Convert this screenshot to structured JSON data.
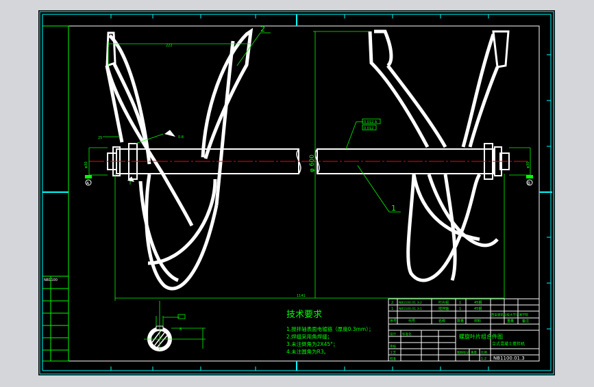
{
  "colors": {
    "viewport_bg": "#d4d6d9",
    "sheet_bg": "#000000",
    "line_white": "#ffffff",
    "line_green": "#00ff00",
    "center_red": "#ff0000",
    "outer_frame_cyan": "#00ffff",
    "text_yellow": "#ffff00"
  },
  "drawing": {
    "balloons": {
      "top_left": "2",
      "right": "1"
    },
    "dims": {
      "top_width": "222",
      "left_small": "25",
      "overall_length": "1141",
      "diameter": "φ 600",
      "left_end_dia": "φ30",
      "right_end_dia": "φ30"
    },
    "tolerance_frames": {
      "upper": "0.012 A",
      "lower": "0.012"
    },
    "datum_left": "A",
    "datum_right": "B",
    "roughness": "0.8"
  },
  "section_view": {
    "keyway_dim": "8"
  },
  "tech_requirements": {
    "heading": "技术要求",
    "items": [
      "1.搅拌轴表面电镀铬（厚度0.3mm）；",
      "2.焊缝采用角焊缝；",
      "3.未注倒角为2X45°；",
      "4.未注圆角为R3。"
    ]
  },
  "title_block": {
    "bom_rows": [
      {
        "no": "2",
        "code": "NB1100.01.3-2",
        "name": "叶片组",
        "qty": "1",
        "material": "45钢"
      },
      {
        "no": "1",
        "code": "NB1100.01.3-1",
        "name": "搅拌轴",
        "qty": "1",
        "material": "45钢"
      }
    ],
    "bom_header": [
      "序号",
      "代号",
      "名称",
      "数量",
      "材料",
      "重量",
      "备注"
    ],
    "school": "西安建筑科技大学华清学院",
    "drawing_title": "螺旋叶片组合件图",
    "product_name": "立式混凝土搅拌机",
    "drawing_number": "NB1100.01.3",
    "scale": "1:2",
    "labels": [
      "设计",
      "标准化",
      "审核",
      "工艺",
      "批准",
      "图样标记",
      "重量",
      "比例"
    ]
  },
  "left_strip": {
    "labels": [
      "NB1100",
      "",
      "",
      "",
      "",
      ""
    ]
  }
}
